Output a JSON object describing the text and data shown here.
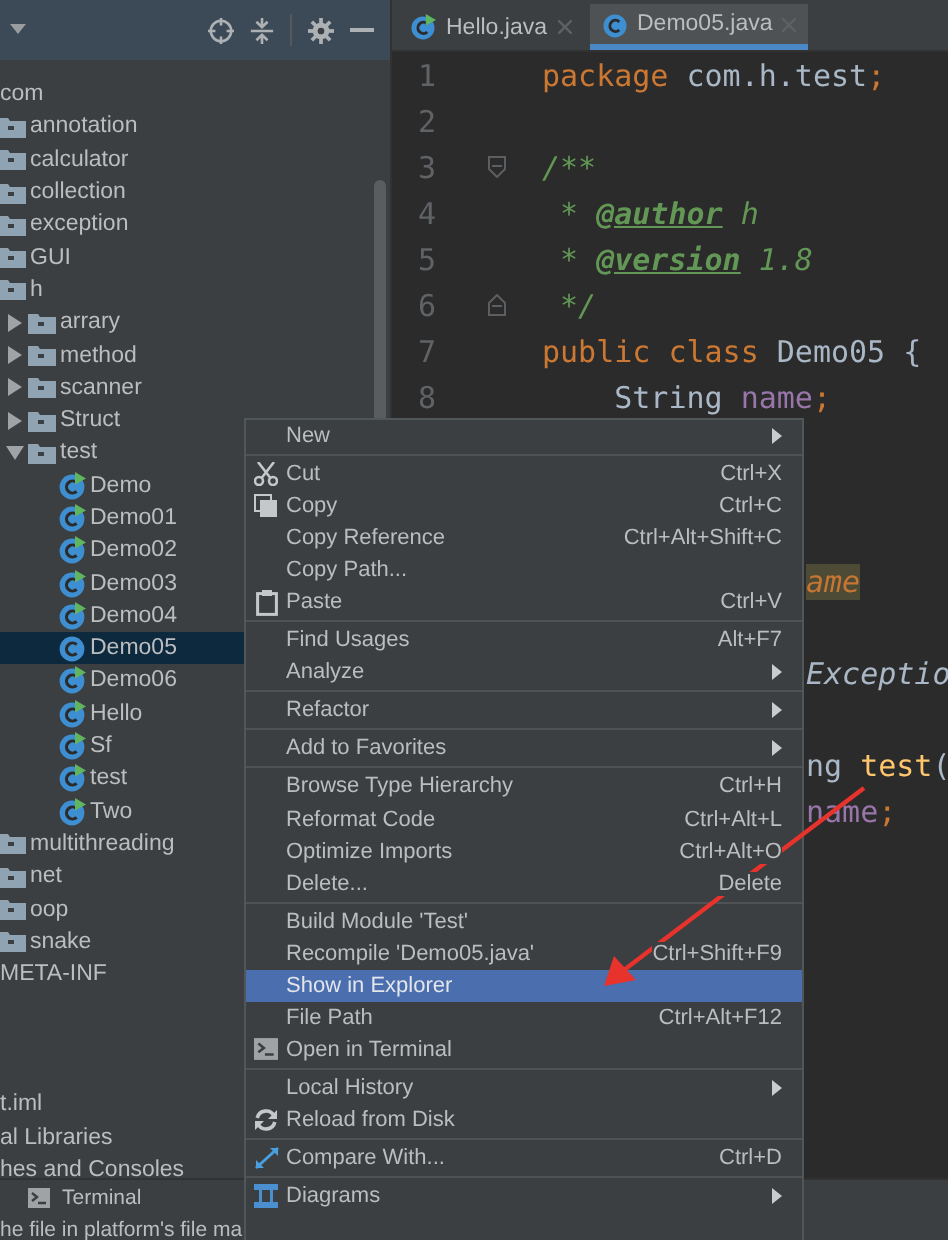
{
  "project_panel": {
    "tree": [
      {
        "label": "com",
        "selected": false,
        "children": [
          {
            "label": "annotation",
            "kind": "folder",
            "selected": false
          },
          {
            "label": "calculator",
            "kind": "folder",
            "selected": false
          },
          {
            "label": "collection",
            "kind": "folder",
            "selected": false
          },
          {
            "label": "exception",
            "kind": "folder",
            "selected": false
          },
          {
            "label": "GUI",
            "kind": "folder",
            "selected": false
          },
          {
            "label": "h",
            "kind": "folder",
            "selected": false,
            "children": [
              {
                "label": "arrary",
                "kind": "folder",
                "selected": false,
                "expanded": false
              },
              {
                "label": "method",
                "kind": "folder",
                "selected": false,
                "expanded": false
              },
              {
                "label": "scanner",
                "kind": "folder",
                "selected": false,
                "expanded": false
              },
              {
                "label": "Struct",
                "kind": "folder",
                "selected": false,
                "expanded": false
              },
              {
                "label": "test",
                "kind": "folder",
                "selected": false,
                "expanded": true,
                "children": [
                  {
                    "label": "Demo",
                    "kind": "class",
                    "runnable": true,
                    "selected": false
                  },
                  {
                    "label": "Demo01",
                    "kind": "class",
                    "runnable": true,
                    "selected": false
                  },
                  {
                    "label": "Demo02",
                    "kind": "class",
                    "runnable": true,
                    "selected": false
                  },
                  {
                    "label": "Demo03",
                    "kind": "class",
                    "runnable": true,
                    "selected": false
                  },
                  {
                    "label": "Demo04",
                    "kind": "class",
                    "runnable": true,
                    "selected": false
                  },
                  {
                    "label": "Demo05",
                    "kind": "class",
                    "runnable": false,
                    "selected": true
                  },
                  {
                    "label": "Demo06",
                    "kind": "class",
                    "runnable": true,
                    "selected": false
                  },
                  {
                    "label": "Hello",
                    "kind": "class",
                    "runnable": true,
                    "selected": false
                  },
                  {
                    "label": "Sf",
                    "kind": "class",
                    "runnable": true,
                    "selected": false
                  },
                  {
                    "label": "test",
                    "kind": "class",
                    "runnable": true,
                    "selected": false
                  },
                  {
                    "label": "Two",
                    "kind": "class",
                    "runnable": true,
                    "selected": false
                  }
                ]
              }
            ]
          },
          {
            "label": "multithreading",
            "kind": "folder",
            "selected": false
          },
          {
            "label": "net",
            "kind": "folder",
            "selected": false
          },
          {
            "label": "oop",
            "kind": "folder",
            "selected": false
          },
          {
            "label": "snake",
            "kind": "folder",
            "selected": false
          }
        ]
      },
      {
        "label": "META-INF",
        "selected": false
      }
    ],
    "other_items": [
      "t.iml",
      "al Libraries",
      "hes and Consoles"
    ]
  },
  "tabs": [
    {
      "label": "Hello.java",
      "runnable": true,
      "selected": false
    },
    {
      "label": "Demo05.java",
      "runnable": false,
      "selected": true
    }
  ],
  "code_lines": [
    {
      "kind": "code",
      "number": "1",
      "tokens": [
        {
          "kind": "kw",
          "text": "package"
        },
        {
          "kind": "plain",
          "text": " com.h.test"
        },
        {
          "kind": "kw",
          "text": ";"
        }
      ]
    },
    {
      "kind": "code",
      "number": "2"
    },
    {
      "kind": "code",
      "number": "3",
      "fold_start": true,
      "tokens": [
        {
          "kind": "doc",
          "text": "/**"
        }
      ]
    },
    {
      "kind": "code",
      "number": "4",
      "tokens": [
        {
          "kind": "doc",
          "text": " * "
        },
        {
          "kind": "doctag",
          "text": "@author"
        },
        {
          "kind": "doc",
          "text": " h"
        }
      ]
    },
    {
      "kind": "code",
      "number": "5",
      "tokens": [
        {
          "kind": "doc",
          "text": " * "
        },
        {
          "kind": "doctag",
          "text": "@version"
        },
        {
          "kind": "doc",
          "text": " 1.8"
        }
      ]
    },
    {
      "kind": "code",
      "number": "6",
      "fold_end": true,
      "tokens": [
        {
          "kind": "doc",
          "text": " */"
        }
      ]
    },
    {
      "kind": "code",
      "number": "7",
      "tokens": [
        {
          "kind": "kw",
          "text": "public class "
        },
        {
          "kind": "plain",
          "text": "Demo05 {"
        }
      ]
    },
    {
      "kind": "code",
      "number": "8",
      "tokens": [
        {
          "kind": "plain",
          "text": "    String "
        },
        {
          "kind": "field",
          "text": "name"
        },
        {
          "kind": "kw",
          "text": ";"
        }
      ]
    },
    {
      "kind": "blank"
    },
    {
      "kind": "blank"
    },
    {
      "kind": "blank"
    },
    {
      "kind": "fragment",
      "tokens": [
        {
          "kind": "param",
          "text": "ame"
        }
      ]
    },
    {
      "kind": "blank"
    },
    {
      "kind": "fragment",
      "tokens": [
        {
          "kind": "type",
          "text": "Exceptio"
        }
      ]
    },
    {
      "kind": "blank"
    },
    {
      "kind": "fragment",
      "tokens": [
        {
          "kind": "plain",
          "text": "ng "
        },
        {
          "kind": "fn",
          "text": "test"
        },
        {
          "kind": "plain",
          "text": "("
        }
      ]
    },
    {
      "kind": "fragment",
      "tokens": [
        {
          "kind": "field",
          "text": "name"
        },
        {
          "kind": "kw",
          "text": ";"
        }
      ]
    }
  ],
  "context_menu": [
    {
      "kind": "item",
      "label": "New",
      "submenu": true,
      "selected": false
    },
    {
      "kind": "separator"
    },
    {
      "kind": "cut",
      "label": "Cut",
      "shortcut": "Ctrl+X",
      "selected": false
    },
    {
      "kind": "copy",
      "label": "Copy",
      "shortcut": "Ctrl+C",
      "selected": false
    },
    {
      "kind": "item",
      "label": "Copy Reference",
      "shortcut": "Ctrl+Alt+Shift+C",
      "selected": false
    },
    {
      "kind": "item",
      "label": "Copy Path...",
      "selected": false
    },
    {
      "kind": "paste",
      "label": "Paste",
      "shortcut": "Ctrl+V",
      "selected": false
    },
    {
      "kind": "separator"
    },
    {
      "kind": "item",
      "label": "Find Usages",
      "shortcut": "Alt+F7",
      "selected": false
    },
    {
      "kind": "item",
      "label": "Analyze",
      "submenu": true,
      "selected": false
    },
    {
      "kind": "separator"
    },
    {
      "kind": "item",
      "label": "Refactor",
      "submenu": true,
      "selected": false
    },
    {
      "kind": "separator"
    },
    {
      "kind": "item",
      "label": "Add to Favorites",
      "submenu": true,
      "selected": false
    },
    {
      "kind": "separator"
    },
    {
      "kind": "item",
      "label": "Browse Type Hierarchy",
      "shortcut": "Ctrl+H",
      "selected": false
    },
    {
      "kind": "item",
      "label": "Reformat Code",
      "shortcut": "Ctrl+Alt+L",
      "selected": false
    },
    {
      "kind": "item",
      "label": "Optimize Imports",
      "shortcut": "Ctrl+Alt+O",
      "selected": false
    },
    {
      "kind": "item",
      "label": "Delete...",
      "shortcut": "Delete",
      "selected": false
    },
    {
      "kind": "separator"
    },
    {
      "kind": "item",
      "label": "Build Module 'Test'",
      "selected": false
    },
    {
      "kind": "item",
      "label": "Recompile 'Demo05.java'",
      "shortcut": "Ctrl+Shift+F9",
      "selected": false
    },
    {
      "kind": "item",
      "label": "Show in Explorer",
      "selected": true
    },
    {
      "kind": "item",
      "label": "File Path",
      "shortcut": "Ctrl+Alt+F12",
      "selected": false
    },
    {
      "kind": "terminal",
      "label": "Open in Terminal",
      "selected": false
    },
    {
      "kind": "separator"
    },
    {
      "kind": "item",
      "label": "Local History",
      "submenu": true,
      "selected": false
    },
    {
      "kind": "reload",
      "label": "Reload from Disk",
      "selected": false
    },
    {
      "kind": "separator"
    },
    {
      "kind": "compare",
      "label": "Compare With...",
      "shortcut": "Ctrl+D",
      "selected": false
    },
    {
      "kind": "separator"
    },
    {
      "kind": "diagram",
      "label": "Diagrams",
      "submenu": true,
      "selected": false
    }
  ],
  "tool_window": {
    "label": "Terminal"
  },
  "status_bar": {
    "text": "he file in platform's file ma"
  }
}
